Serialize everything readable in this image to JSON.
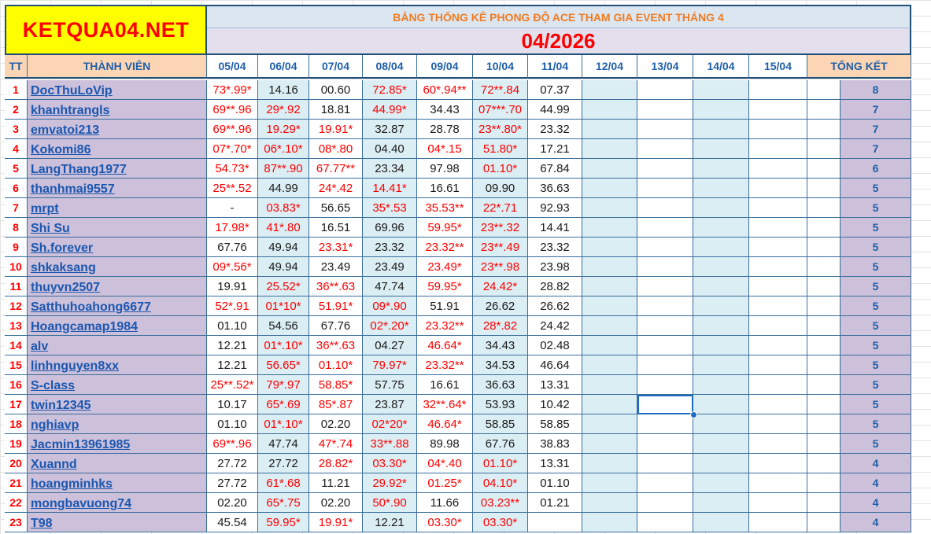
{
  "logo": "KETQUA04.NET",
  "banner": "BẢNG THỐNG KÊ PHONG ĐỘ ACE THAM GIA EVENT THÁNG 4",
  "month": "04/2026",
  "headers": {
    "tt": "TT",
    "member": "THÀNH VIÊN",
    "dates": [
      "05/04",
      "06/04",
      "07/04",
      "08/04",
      "09/04",
      "10/04",
      "11/04",
      "12/04",
      "13/04",
      "14/04",
      "15/04"
    ],
    "total": "TỔNG KẾT"
  },
  "rows": [
    {
      "tt": "1",
      "name": "DocThuLoVip",
      "vals": [
        "73*.99*",
        "14.16",
        "00.60",
        "72.85*",
        "60*.94**",
        "72**.84",
        "07.37"
      ],
      "hits": [
        1,
        0,
        0,
        1,
        1,
        1,
        0
      ],
      "total": "8"
    },
    {
      "tt": "2",
      "name": "khanhtrangls",
      "vals": [
        "69**.96",
        "29*.92",
        "18.81",
        "44.99*",
        "34.43",
        "07***.70",
        "44.99"
      ],
      "hits": [
        1,
        1,
        0,
        1,
        0,
        1,
        0
      ],
      "total": "7"
    },
    {
      "tt": "3",
      "name": "emvatoi213",
      "vals": [
        "69**.96",
        "19.29*",
        "19.91*",
        "32.87",
        "28.78",
        "23**.80*",
        "23.32"
      ],
      "hits": [
        1,
        1,
        1,
        0,
        0,
        1,
        0
      ],
      "total": "7"
    },
    {
      "tt": "4",
      "name": "Kokomi86",
      "vals": [
        "07*.70*",
        "06*.10*",
        "08*.80",
        "04.40",
        "04*.15",
        "51.80*",
        "17.21"
      ],
      "hits": [
        1,
        1,
        1,
        0,
        1,
        1,
        0
      ],
      "total": "7"
    },
    {
      "tt": "5",
      "name": "LangThang1977",
      "vals": [
        "54.73*",
        "87**.90",
        "67.77**",
        "23.34",
        "97.98",
        "01.10*",
        "67.84"
      ],
      "hits": [
        1,
        1,
        1,
        0,
        0,
        1,
        0
      ],
      "total": "6"
    },
    {
      "tt": "6",
      "name": "thanhmai9557",
      "vals": [
        "25**.52",
        "44.99",
        "24*.42",
        "14.41*",
        "16.61",
        "09.90",
        "36.63"
      ],
      "hits": [
        1,
        0,
        1,
        1,
        0,
        0,
        0
      ],
      "total": "5"
    },
    {
      "tt": "7",
      "name": "mrpt",
      "vals": [
        "-",
        "03.83*",
        "56.65",
        "35*.53",
        "35.53**",
        "22*.71",
        "92.93"
      ],
      "hits": [
        0,
        1,
        0,
        1,
        1,
        1,
        0
      ],
      "total": "5"
    },
    {
      "tt": "8",
      "name": "Shi Su",
      "vals": [
        "17.98*",
        "41*.80",
        "16.51",
        "69.96",
        "59.95*",
        "23**.32",
        "14.41"
      ],
      "hits": [
        1,
        1,
        0,
        0,
        1,
        1,
        0
      ],
      "total": "5"
    },
    {
      "tt": "9",
      "name": "Sh.forever",
      "vals": [
        "67.76",
        "49.94",
        "23.31*",
        "23.32",
        "23.32**",
        "23**.49",
        "23.32"
      ],
      "hits": [
        0,
        0,
        1,
        0,
        1,
        1,
        0
      ],
      "total": "5"
    },
    {
      "tt": "10",
      "name": "shkaksang",
      "vals": [
        "09*.56*",
        "49.94",
        "23.49",
        "23.49",
        "23.49*",
        "23**.98",
        "23.98"
      ],
      "hits": [
        1,
        0,
        0,
        0,
        1,
        1,
        0
      ],
      "total": "5"
    },
    {
      "tt": "11",
      "name": "thuyvn2507",
      "vals": [
        "19.91",
        "25.52*",
        "36**.63",
        "47.74",
        "59.95*",
        "24.42*",
        "28.82"
      ],
      "hits": [
        0,
        1,
        1,
        0,
        1,
        1,
        0
      ],
      "total": "5"
    },
    {
      "tt": "12",
      "name": "Satthuhoahong6677",
      "vals": [
        "52*.91",
        "01*10*",
        "51.91*",
        "09*.90",
        "51.91",
        "26.62",
        "26.62"
      ],
      "hits": [
        1,
        1,
        1,
        1,
        0,
        0,
        0
      ],
      "total": "5"
    },
    {
      "tt": "13",
      "name": "Hoangcamap1984",
      "vals": [
        "01.10",
        "54.56",
        "67.76",
        "02*.20*",
        "23.32**",
        "28*.82",
        "24.42"
      ],
      "hits": [
        0,
        0,
        0,
        1,
        1,
        1,
        0
      ],
      "total": "5"
    },
    {
      "tt": "14",
      "name": "alv",
      "vals": [
        "12.21",
        "01*.10*",
        "36**.63",
        "04.27",
        "46.64*",
        "34.43",
        "02.48"
      ],
      "hits": [
        0,
        1,
        1,
        0,
        1,
        0,
        0
      ],
      "total": "5"
    },
    {
      "tt": "15",
      "name": "linhnguyen8xx",
      "vals": [
        "12.21",
        "56.65*",
        "01.10*",
        "79.97*",
        "23.32**",
        "34.53",
        "46.64"
      ],
      "hits": [
        0,
        1,
        1,
        1,
        1,
        0,
        0
      ],
      "total": "5"
    },
    {
      "tt": "16",
      "name": "S-class",
      "vals": [
        "25**.52*",
        "79*.97",
        "58.85*",
        "57.75",
        "16.61",
        "36.63",
        "13.31"
      ],
      "hits": [
        1,
        1,
        1,
        0,
        0,
        0,
        0
      ],
      "total": "5"
    },
    {
      "tt": "17",
      "name": "twin12345",
      "vals": [
        "10.17",
        "65*.69",
        "85*.87",
        "23.87",
        "32**.64*",
        "53.93",
        "10.42"
      ],
      "hits": [
        0,
        1,
        1,
        0,
        1,
        0,
        0
      ],
      "total": "5"
    },
    {
      "tt": "18",
      "name": "nghiavp",
      "vals": [
        "01.10",
        "01*.10*",
        "02.20",
        "02*20*",
        "46.64*",
        "58.85",
        "58.85"
      ],
      "hits": [
        0,
        1,
        0,
        1,
        1,
        0,
        0
      ],
      "total": "5"
    },
    {
      "tt": "19",
      "name": "Jacmin13961985",
      "vals": [
        "69**.96",
        "47.74",
        "47*.74",
        "33**.88",
        "89.98",
        "67.76",
        "38.83"
      ],
      "hits": [
        1,
        0,
        1,
        1,
        0,
        0,
        0
      ],
      "total": "5"
    },
    {
      "tt": "20",
      "name": "Xuannd",
      "vals": [
        "27.72",
        "27.72",
        "28.82*",
        "03.30*",
        "04*.40",
        "01.10*",
        "13.31"
      ],
      "hits": [
        0,
        0,
        1,
        1,
        1,
        1,
        0
      ],
      "total": "4"
    },
    {
      "tt": "21",
      "name": "hoangminhks",
      "vals": [
        "27.72",
        "61*.68",
        "11.21",
        "29.92*",
        "01.25*",
        "04.10*",
        "01.10"
      ],
      "hits": [
        0,
        1,
        0,
        1,
        1,
        1,
        0
      ],
      "total": "4"
    },
    {
      "tt": "22",
      "name": "mongbavuong74",
      "vals": [
        "02.20",
        "65*.75",
        "02.20",
        "50*.90",
        "11.66",
        "03.23**",
        "01.21"
      ],
      "hits": [
        0,
        1,
        0,
        1,
        0,
        1,
        0
      ],
      "total": "4"
    },
    {
      "tt": "23",
      "name": "T98",
      "vals": [
        "45.54",
        "59.95*",
        "19.91*",
        "12.21",
        "03.30*",
        "03.30*",
        ""
      ],
      "hits": [
        0,
        1,
        1,
        0,
        1,
        1,
        0
      ],
      "total": "4"
    }
  ],
  "colors": {
    "logo_bg": "#ffff00",
    "logo_text": "#ff0000",
    "name_bg": "#ccc0da",
    "header_bg": "#fcd5b4",
    "alt_col_bg": "#dbeef4",
    "hit_text": "#ff0000",
    "link_text": "#1b57b0"
  }
}
